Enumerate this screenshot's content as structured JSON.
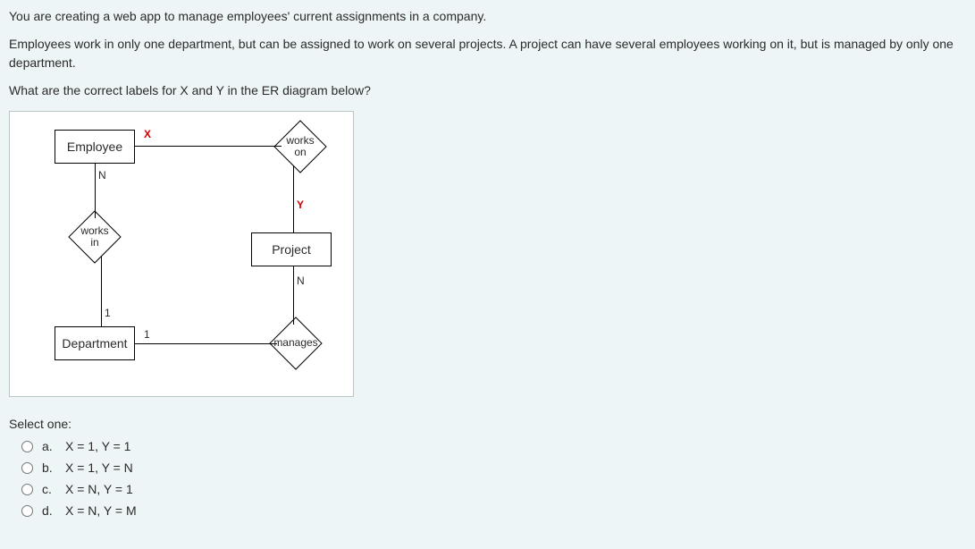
{
  "question": {
    "p1": "You are creating a web app to manage employees' current assignments in a company.",
    "p2": "Employees work in only one department, but can be assigned to work on several projects. A project can have several employees working on it, but is managed by only one department.",
    "p3": "What are the correct labels for X and Y in the ER diagram below?"
  },
  "diagram": {
    "entity_employee": "Employee",
    "entity_project": "Project",
    "entity_department": "Department",
    "rel_works_on": "works\non",
    "rel_works_in": "works\nin",
    "rel_manages": "manages",
    "card_x": "X",
    "card_y": "Y",
    "card_n1": "N",
    "card_n2": "N",
    "card_1a": "1",
    "card_1b": "1"
  },
  "answers": {
    "header": "Select one:",
    "options": [
      {
        "letter": "a.",
        "text": "X = 1, Y = 1"
      },
      {
        "letter": "b.",
        "text": "X = 1, Y = N"
      },
      {
        "letter": "c.",
        "text": "X = N, Y = 1"
      },
      {
        "letter": "d.",
        "text": "X = N, Y = M"
      }
    ]
  }
}
